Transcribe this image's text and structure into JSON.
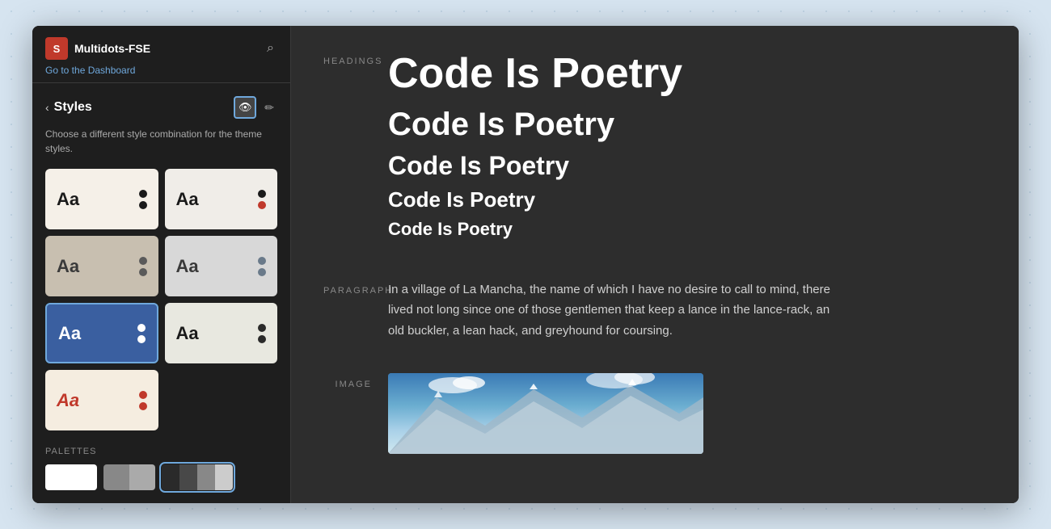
{
  "app": {
    "logo_text": "S",
    "name": "Multidots-FSE",
    "dashboard_link": "Go to the Dashboard"
  },
  "sidebar": {
    "title": "Styles",
    "description": "Choose a different style combination for the theme styles.",
    "back_label": "‹",
    "eye_icon": "👁",
    "edit_icon": "✏",
    "search_icon": "🔍",
    "style_cards": [
      {
        "id": 1,
        "aa_text": "Aa",
        "bg": "#f5f0e8",
        "aa_color": "#1a1a1a",
        "dot1": "#1a1a1a",
        "dot2": "#1a1a1a"
      },
      {
        "id": 2,
        "aa_text": "Aa",
        "bg": "#f0ede8",
        "aa_color": "#1a1a1a",
        "dot1": "#1a1a1a",
        "dot2": "#c0392b"
      },
      {
        "id": 3,
        "aa_text": "Aa",
        "bg": "#c8bfb0",
        "aa_color": "#3a3a3a",
        "dot1": "#5a5a5a",
        "dot2": "#5a5a5a"
      },
      {
        "id": 4,
        "aa_text": "Aa",
        "bg": "#d8d8d8",
        "aa_color": "#3a3a3a",
        "dot1": "#6a7a8a",
        "dot2": "#6a7a8a"
      },
      {
        "id": 5,
        "aa_text": "Aa",
        "bg": "#3a5fa0",
        "aa_color": "#ffffff",
        "dot1": "#ffffff",
        "dot2": "#ffffff",
        "selected": true
      },
      {
        "id": 6,
        "aa_text": "Aa",
        "bg": "#e8e8e0",
        "aa_color": "#1a1a1a",
        "dot1": "#2a2a2a",
        "dot2": "#2a2a2a"
      },
      {
        "id": 7,
        "aa_text": "Aa",
        "bg": "#f5ede0",
        "aa_color": "#c0392b",
        "dot1": "#c0392b",
        "dot2": "#c0392b",
        "italic": true
      }
    ],
    "palettes_label": "PALETTES",
    "palettes": [
      {
        "id": 1,
        "colors": [
          "#ffffff",
          "#ffffff"
        ]
      },
      {
        "id": 2,
        "colors": [
          "#888888",
          "#aaaaaa"
        ]
      },
      {
        "id": 3,
        "colors": [
          "#2a2a2a",
          "#555555",
          "#888888",
          "#cccccc"
        ],
        "selected": true
      }
    ]
  },
  "main": {
    "sections": {
      "headings": {
        "label": "HEADINGS",
        "h1": "Code Is Poetry",
        "h2": "Code Is Poetry",
        "h3": "Code Is Poetry",
        "h4": "Code Is Poetry",
        "h5": "Code Is Poetry"
      },
      "paragraph": {
        "label": "PARAGRAPH",
        "text": "In a village of La Mancha, the name of which I have no desire to call to mind, there lived not long since one of those gentlemen that keep a lance in the lance-rack, an old buckler, a lean hack, and greyhound for coursing."
      },
      "image": {
        "label": "IMAGE"
      }
    }
  }
}
